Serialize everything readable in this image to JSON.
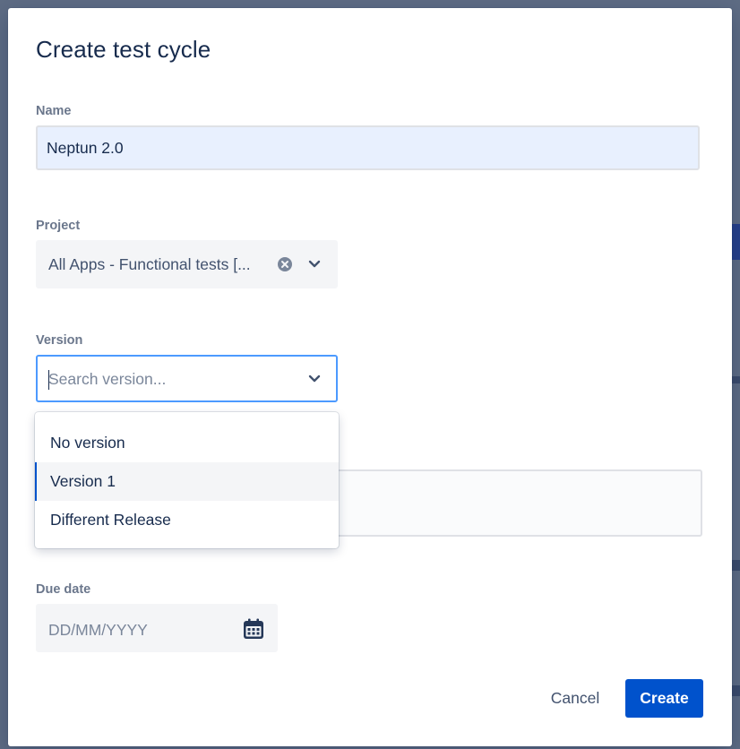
{
  "modal": {
    "title": "Create test cycle"
  },
  "form": {
    "name": {
      "label": "Name",
      "value": "Neptun 2.0"
    },
    "project": {
      "label": "Project",
      "value": "All Apps - Functional tests [..."
    },
    "version": {
      "label": "Version",
      "placeholder": "Search version...",
      "options": [
        "No version",
        "Version 1",
        "Different Release"
      ],
      "highlighted_option": "Version 1"
    },
    "due_date": {
      "label": "Due date",
      "placeholder": "DD/MM/YYYY"
    }
  },
  "footer": {
    "cancel_label": "Cancel",
    "create_label": "Create"
  },
  "icons": {
    "clear": "clear-circle-icon",
    "chevron": "chevron-down-icon",
    "calendar": "calendar-icon"
  },
  "colors": {
    "primary": "#0052cc",
    "focus_border": "#4c9aff",
    "overlay": "#5e6c84"
  }
}
